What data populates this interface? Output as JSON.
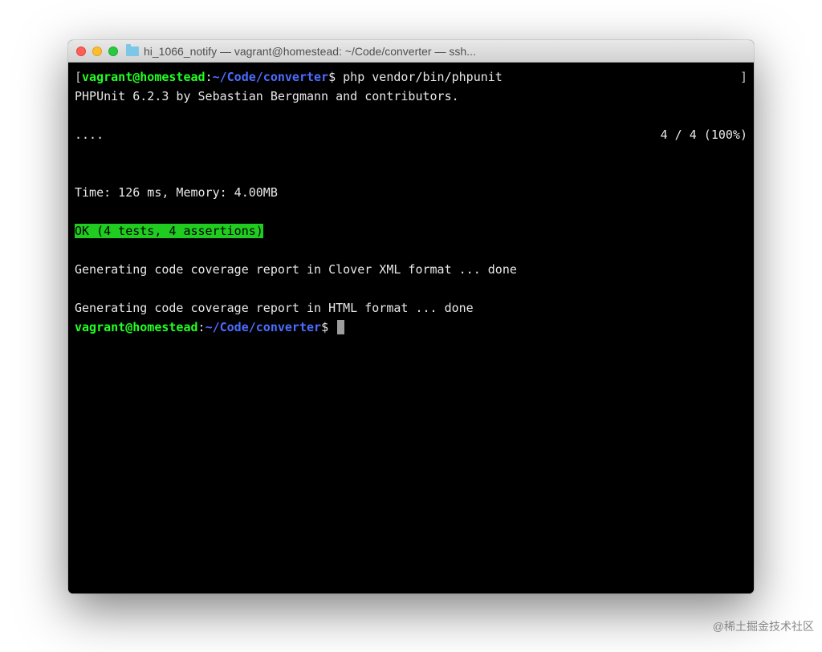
{
  "titlebar": {
    "title": "hi_1066_notify — vagrant@homestead: ~/Code/converter — ssh..."
  },
  "terminal": {
    "prompt1": {
      "lbracket": "[",
      "userhost": "vagrant@homestead",
      "colon": ":",
      "path": "~/Code/converter",
      "dollar": "$",
      "command": "php vendor/bin/phpunit",
      "rbracket": "]"
    },
    "lines": {
      "phpunit_banner": "PHPUnit 6.2.3 by Sebastian Bergmann and contributors.",
      "dots": "....",
      "progress": "4 / 4 (100%)",
      "time_memory": "Time: 126 ms, Memory: 4.00MB",
      "ok": "OK (4 tests, 4 assertions)",
      "cov_clover": "Generating code coverage report in Clover XML format ... done",
      "cov_html": "Generating code coverage report in HTML format ... done"
    },
    "prompt2": {
      "userhost": "vagrant@homestead",
      "colon": ":",
      "path": "~/Code/converter",
      "dollar": "$"
    }
  },
  "watermark": "@稀土掘金技术社区"
}
